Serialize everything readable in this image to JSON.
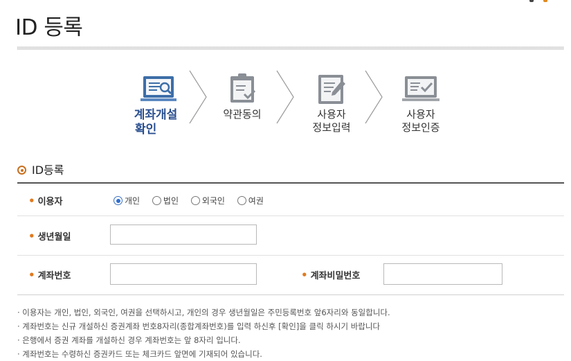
{
  "page": {
    "title": "ID 등록"
  },
  "steps": [
    {
      "label_line1": "계좌개설",
      "label_line2": "확인",
      "icon": "account-confirm-icon",
      "active": true
    },
    {
      "label_line1": "약관동의",
      "label_line2": "",
      "icon": "clipboard-check-icon",
      "active": false
    },
    {
      "label_line1": "사용자",
      "label_line2": "정보입력",
      "icon": "document-edit-icon",
      "active": false
    },
    {
      "label_line1": "사용자",
      "label_line2": "정보인증",
      "icon": "monitor-check-icon",
      "active": false
    }
  ],
  "section": {
    "title": "ID등록"
  },
  "form": {
    "user_type": {
      "label": "이용자",
      "options": [
        "개인",
        "법인",
        "외국인",
        "여권"
      ],
      "selected": "개인"
    },
    "birth": {
      "label": "생년월일",
      "value": ""
    },
    "account_no": {
      "label": "계좌번호",
      "value": ""
    },
    "account_pw": {
      "label": "계좌비밀번호",
      "value": ""
    }
  },
  "notes": [
    "· 이용자는 개인, 법인, 외국인, 여권을 선택하시고, 개인의 경우 생년월일은 주민등록번호 앞6자리와 동일합니다.",
    "· 계좌번호는 신규 개설하신 증권계좌 번호8자리(종합계좌번호)를 입력 하신후 [확인]을 클릭 하시기 바랍니다",
    "· 은행에서 증권 계좌를 개설하신 경우 계좌번호는 앞 8자리 입니다.",
    "· 계좌번호는 수령하신 증권카드 또는 체크카드 앞면에 기재되어 있습니다."
  ],
  "colors": {
    "accent_orange": "#e07a1f",
    "active_step": "#2a4f8f",
    "icon_active": "#3d6ea8",
    "icon_inactive": "#8a8f96",
    "radio_selected": "#2f6fd0"
  }
}
